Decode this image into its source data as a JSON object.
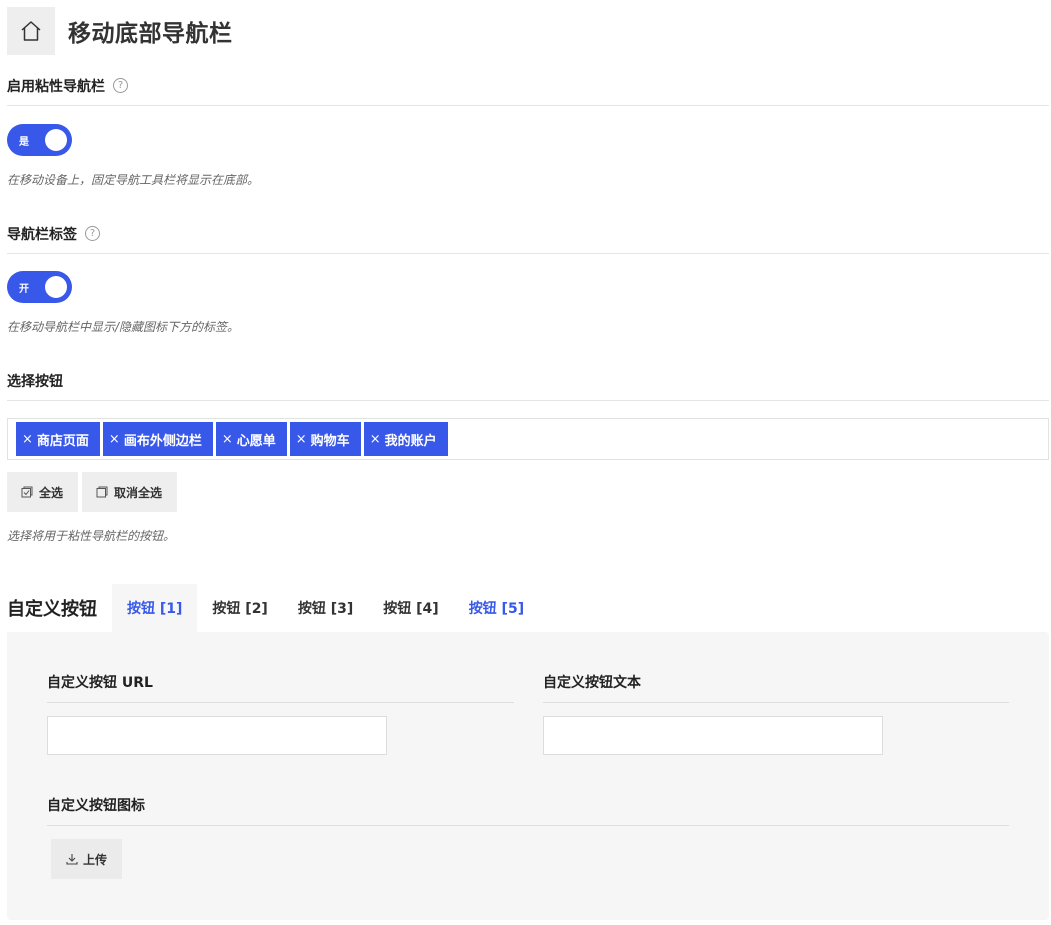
{
  "header": {
    "title": "移动底部导航栏",
    "home_icon": "home-icon"
  },
  "sticky": {
    "title": "启用粘性导航栏",
    "help": "?",
    "toggle_label": "是",
    "description": "在移动设备上，固定导航工具栏将显示在底部。",
    "enabled": true
  },
  "labels": {
    "title": "导航栏标签",
    "help": "?",
    "toggle_label": "开",
    "description": "在移动导航栏中显示/隐藏图标下方的标签。",
    "enabled": true
  },
  "select_buttons": {
    "title": "选择按钮",
    "tags": [
      "商店页面",
      "画布外侧边栏",
      "心愿单",
      "购物车",
      "我的账户"
    ],
    "remove_glyph": "×",
    "select_all": "全选",
    "deselect_all": "取消全选",
    "description": "选择将用于粘性导航栏的按钮。"
  },
  "custom": {
    "title": "自定义按钮",
    "tabs": [
      "按钮 [1]",
      "按钮 [2]",
      "按钮 [3]",
      "按钮 [4]",
      "按钮 [5]"
    ],
    "active_tab": 0,
    "url_label": "自定义按钮 URL",
    "url_value": "",
    "text_label": "自定义按钮文本",
    "text_value": "",
    "icon_label": "自定义按钮图标",
    "upload_label": "上传"
  },
  "colors": {
    "accent": "#3858e9",
    "panel": "#f6f6f6",
    "button": "#eeeeee"
  }
}
